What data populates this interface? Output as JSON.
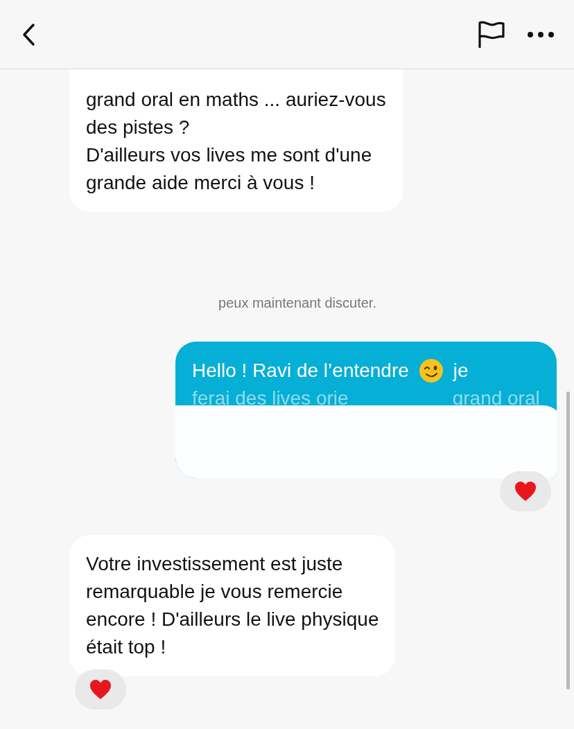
{
  "messages": [
    {
      "kind": "incoming",
      "lines": [
        "grand oral en maths ... auriez-vous",
        "des pistes ?",
        "D'ailleurs vos lives me sont d'une",
        "grande aide merci à vous !"
      ],
      "reacted": false
    },
    {
      "kind": "system",
      "text": "peux maintenant discuter."
    },
    {
      "kind": "outgoing",
      "segments": [
        {
          "kind": "text",
          "text": "Hello ! Ravi de l’entendre"
        },
        {
          "kind": "emoji"
        },
        {
          "kind": "text",
          "text": "je"
        }
      ],
      "partial": [
        "ferai des lives orie",
        "grand oral"
      ],
      "redacted": true,
      "reacted": true
    },
    {
      "kind": "incoming",
      "lines": [
        "Votre investissement est juste",
        "remarquable je vous remercie",
        "encore ! D'ailleurs le live physique",
        "était top !"
      ],
      "reacted": true
    }
  ]
}
